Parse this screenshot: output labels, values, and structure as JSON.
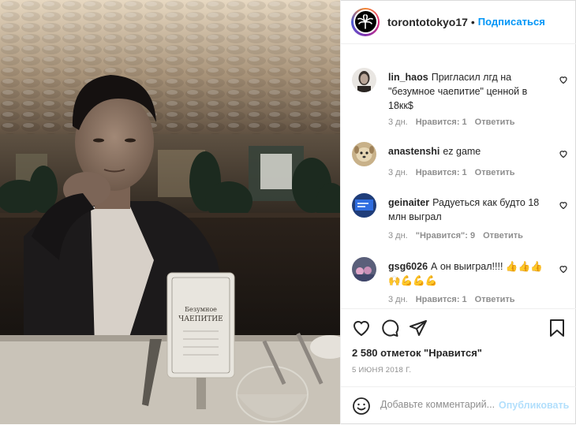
{
  "post": {
    "username": "torontotokyo17",
    "separator": "•",
    "follow_label": "Подписаться"
  },
  "comments": [
    {
      "user": "lin_haos",
      "text": "Пригласил лгд на \"безумное чаепитие\" ценной в 18кк$",
      "time": "3 дн.",
      "likes": "Нравится: 1",
      "reply": "Ответить",
      "avatar_icon": "portrait-avatar"
    },
    {
      "user": "anastenshi",
      "text": "ez game",
      "time": "3 дн.",
      "likes": "Нравится: 1",
      "reply": "Ответить",
      "avatar_icon": "dog-avatar"
    },
    {
      "user": "geinaiter",
      "text": "Радуеться как будто 18 млн выграл",
      "time": "3 дн.",
      "likes": "\"Нравится\": 9",
      "reply": "Ответить",
      "avatar_icon": "blue-screen-avatar"
    },
    {
      "user": "gsg6026",
      "text": "А он выиграл!!!! 👍👍👍 🙌💪💪💪",
      "time": "3 дн.",
      "likes": "Нравится: 1",
      "reply": "Ответить",
      "avatar_icon": "crowd-avatar"
    }
  ],
  "actions": {
    "icons": [
      "heart-icon",
      "comment-icon",
      "share-icon",
      "bookmark-icon"
    ]
  },
  "likes_text": "2 580 отметок \"Нравится\"",
  "date_text": "5 ИЮНЯ 2018 Г.",
  "add_comment": {
    "placeholder": "Добавьте комментарий...",
    "publish_label": "Опубликовать"
  },
  "photo": {
    "menu_title": "Безумное чаепитие",
    "menu_title_line1": "Безумное",
    "menu_title_line2": "ЧАЕПИТИЕ"
  },
  "colors": {
    "accent": "#0095f6",
    "publish_disabled": "#b2dffc",
    "muted": "#8e8e8e"
  }
}
